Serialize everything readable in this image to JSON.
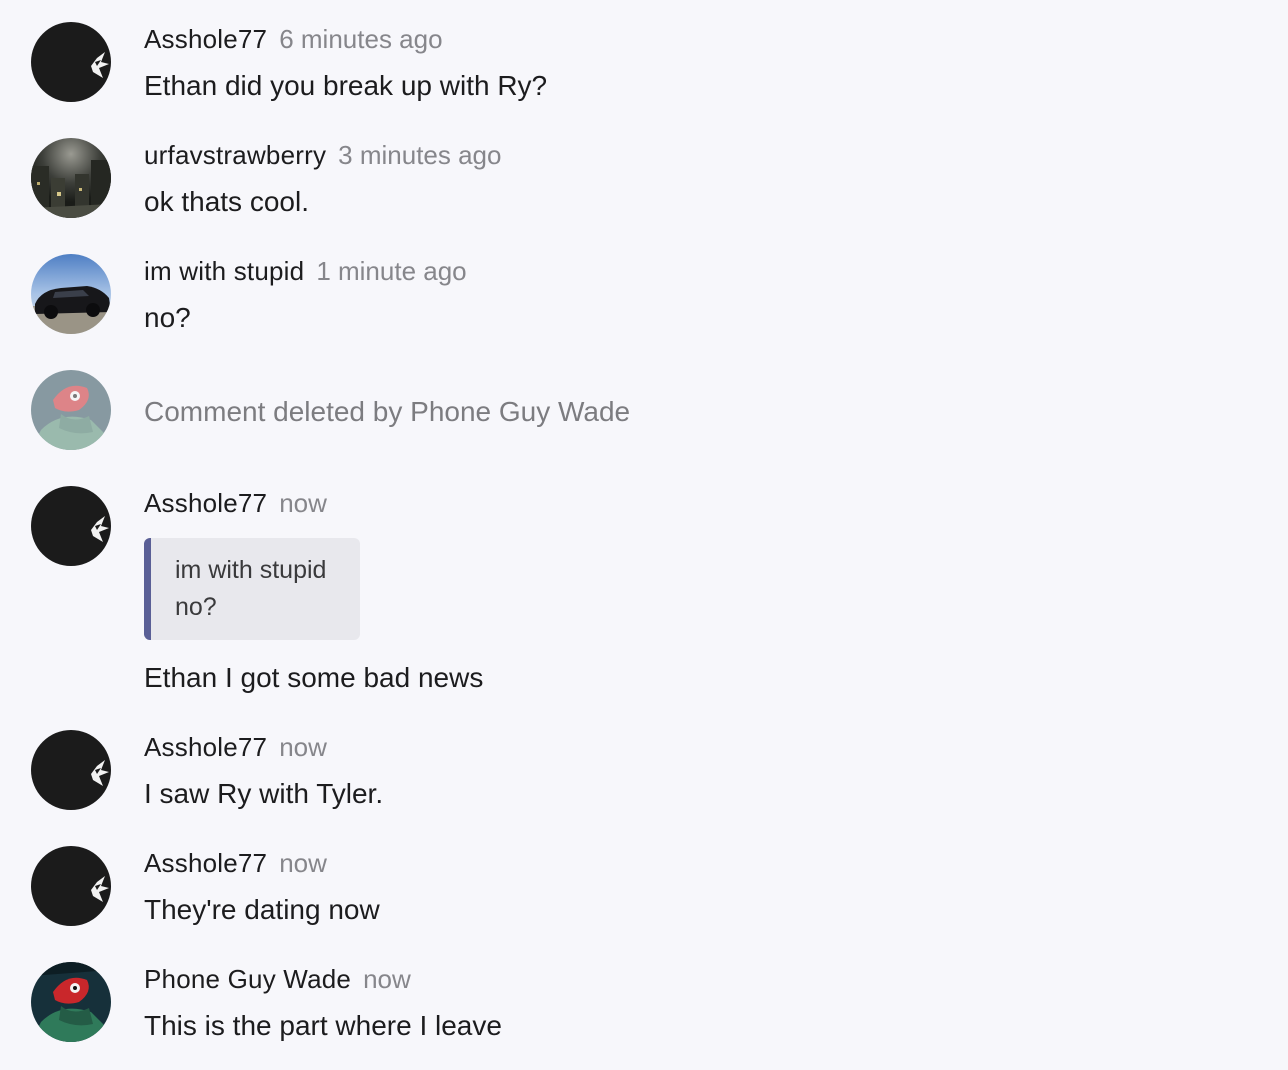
{
  "comments": [
    {
      "username": "Asshole77",
      "timestamp": "6 minutes ago",
      "text": "Ethan did you break up with Ry?",
      "avatar_icon": "dark-silhouette-avatar"
    },
    {
      "username": "urfavstrawberry",
      "timestamp": "3 minutes ago",
      "text": "ok thats cool.",
      "avatar_icon": "night-street-avatar"
    },
    {
      "username": "im with stupid",
      "timestamp": "1 minute ago",
      "text": "no?",
      "avatar_icon": "black-car-avatar"
    },
    {
      "deleted_text": "Comment deleted by Phone Guy Wade",
      "avatar_icon": "red-creature-avatar-faded"
    },
    {
      "username": "Asshole77",
      "timestamp": "now",
      "quote": {
        "username": "im with stupid",
        "text": "no?"
      },
      "text": "Ethan I got some bad news",
      "avatar_icon": "dark-silhouette-avatar"
    },
    {
      "username": "Asshole77",
      "timestamp": "now",
      "text": "I saw Ry with Tyler.",
      "avatar_icon": "dark-silhouette-avatar"
    },
    {
      "username": "Asshole77",
      "timestamp": "now",
      "text": "They're dating now",
      "avatar_icon": "dark-silhouette-avatar"
    },
    {
      "username": "Phone Guy Wade",
      "timestamp": "now",
      "text": "This is the part where I leave",
      "avatar_icon": "red-creature-avatar"
    }
  ],
  "colors": {
    "background": "#f7f7fb",
    "username": "#1c1c1e",
    "timestamp": "#86868b",
    "quote_background": "#e8e8ed",
    "quote_bar": "#5a5f96",
    "deleted_text": "#7c7c80"
  }
}
